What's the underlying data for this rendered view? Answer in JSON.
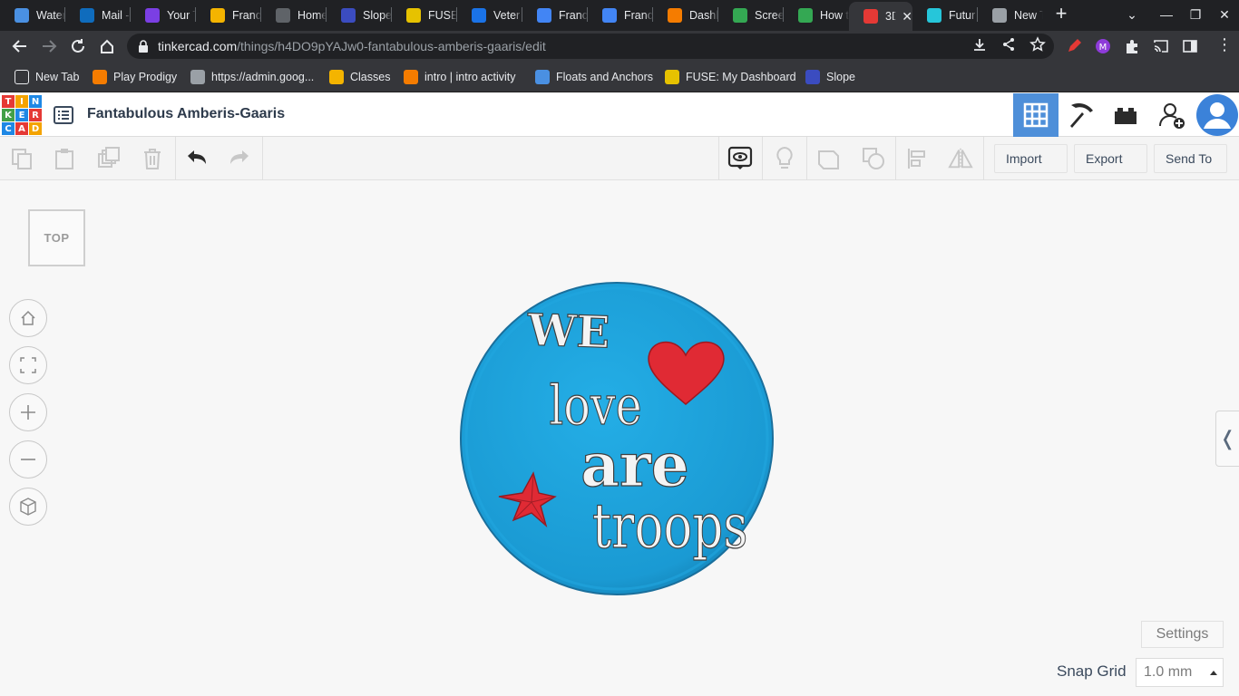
{
  "browser": {
    "tabs": [
      {
        "label": "Water",
        "favicon": "hydro-icon",
        "color": "#4a90e2"
      },
      {
        "label": "Mail -",
        "favicon": "outlook-icon",
        "color": "#0f6cbd"
      },
      {
        "label": "Your T",
        "favicon": "classroom-person-icon",
        "color": "#7b3fe4"
      },
      {
        "label": "Franc",
        "favicon": "slides-icon",
        "color": "#f4b400"
      },
      {
        "label": "Home",
        "favicon": "spiral-icon",
        "color": "#5f6368"
      },
      {
        "label": "Slope",
        "favicon": "slope-icon",
        "color": "#3b4cc0"
      },
      {
        "label": "FUSE",
        "favicon": "fuse-icon",
        "color": "#e6c200"
      },
      {
        "label": "Veter",
        "favicon": "classroom-person-icon",
        "color": "#1a73e8"
      },
      {
        "label": "Franc",
        "favicon": "docs-icon",
        "color": "#4285f4"
      },
      {
        "label": "Franc",
        "favicon": "docs-icon",
        "color": "#4285f4"
      },
      {
        "label": "Dashl",
        "favicon": "dashlane-icon",
        "color": "#f57c00"
      },
      {
        "label": "Scree",
        "favicon": "drive-icon",
        "color": "#34a853"
      },
      {
        "label": "How t",
        "favicon": "drive-icon",
        "color": "#34a853"
      },
      {
        "label": "3D",
        "favicon": "tinkercad-icon",
        "color": "#e53935",
        "active": true
      },
      {
        "label": "Futur",
        "favicon": "future-icon",
        "color": "#26c6da"
      },
      {
        "label": "New T",
        "favicon": "chrome-icon",
        "color": "#9aa0a6"
      }
    ],
    "url_host": "tinkercad.com",
    "url_path": "/things/h4DO9pYAJw0-fantabulous-amberis-gaaris/edit",
    "bookmarks": [
      {
        "label": "New Tab",
        "favicon": "folder-icon",
        "color": "#e8eaed"
      },
      {
        "label": "Play Prodigy",
        "favicon": "prodigy-icon",
        "color": "#f57c00"
      },
      {
        "label": "https://admin.goog...",
        "favicon": "globe-icon",
        "color": "#9aa0a6"
      },
      {
        "label": "Classes",
        "favicon": "classroom-icon",
        "color": "#f4b400"
      },
      {
        "label": "intro | intro activity",
        "favicon": "e-icon",
        "color": "#f57c00"
      },
      {
        "label": "Floats and Anchors",
        "favicon": "d-icon",
        "color": "#4a90e2"
      },
      {
        "label": "FUSE: My Dashboard",
        "favicon": "fuse-icon",
        "color": "#e6c200"
      },
      {
        "label": "Slope",
        "favicon": "slope-icon",
        "color": "#3b4cc0"
      }
    ]
  },
  "app": {
    "logo_letters": [
      "T",
      "I",
      "N",
      "K",
      "E",
      "R",
      "C",
      "A",
      "D"
    ],
    "design_title": "Fantabulous Amberis-Gaaris"
  },
  "toolbar": {
    "import_label": "Import",
    "export_label": "Export",
    "send_to_label": "Send To"
  },
  "workplane": {
    "view_cube_label": "TOP",
    "settings_label": "Settings",
    "snap_grid_label": "Snap Grid",
    "snap_grid_value": "1.0 mm"
  },
  "model": {
    "text_we": "WE",
    "text_love": "love",
    "text_are": "are",
    "text_troops": "troops",
    "disc_color": "#1c9fd8",
    "shape_color": "#e02a34"
  }
}
